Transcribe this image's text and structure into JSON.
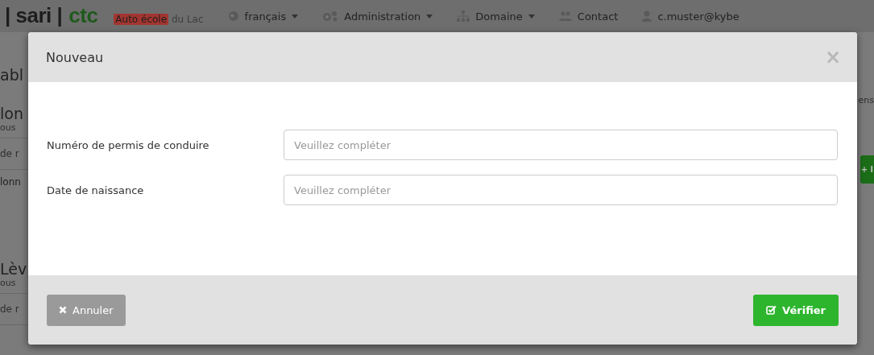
{
  "header": {
    "logo": [
      "| sari |",
      "ctc"
    ],
    "school": {
      "badge": "Auto école",
      "rest": "du Lac"
    },
    "nav": [
      {
        "label": "français",
        "dropdown": true
      },
      {
        "label": "Administration",
        "dropdown": true
      },
      {
        "label": "Domaine",
        "dropdown": true
      },
      {
        "label": "Contact",
        "dropdown": false
      },
      {
        "label": "c.muster@kybe",
        "dropdown": false
      }
    ]
  },
  "left_fragments": [
    {
      "kind": "title",
      "text": "abl"
    },
    {
      "kind": "heading",
      "text": "lon"
    },
    {
      "kind": "hint",
      "text": "ous"
    },
    {
      "kind": "field",
      "text": "de r"
    },
    {
      "kind": "row",
      "text": "lonn"
    },
    {
      "kind": "heading",
      "text": "Lèv"
    },
    {
      "kind": "hint",
      "text": "ous"
    },
    {
      "kind": "field",
      "text": "de r"
    }
  ],
  "right_fragments": [
    {
      "kind": "text",
      "text": "ens"
    },
    {
      "kind": "button",
      "text": "+ l"
    }
  ],
  "modal": {
    "title": "Nouveau",
    "close": "×",
    "fields": [
      {
        "label": "Numéro de permis de conduire",
        "placeholder": "Veuillez compléter"
      },
      {
        "label": "Date de naissance",
        "placeholder": "Veuillez compléter"
      }
    ],
    "buttons": [
      {
        "kind": "cancel",
        "label": "Annuler"
      },
      {
        "kind": "confirm",
        "label": "Vérifier"
      }
    ]
  }
}
